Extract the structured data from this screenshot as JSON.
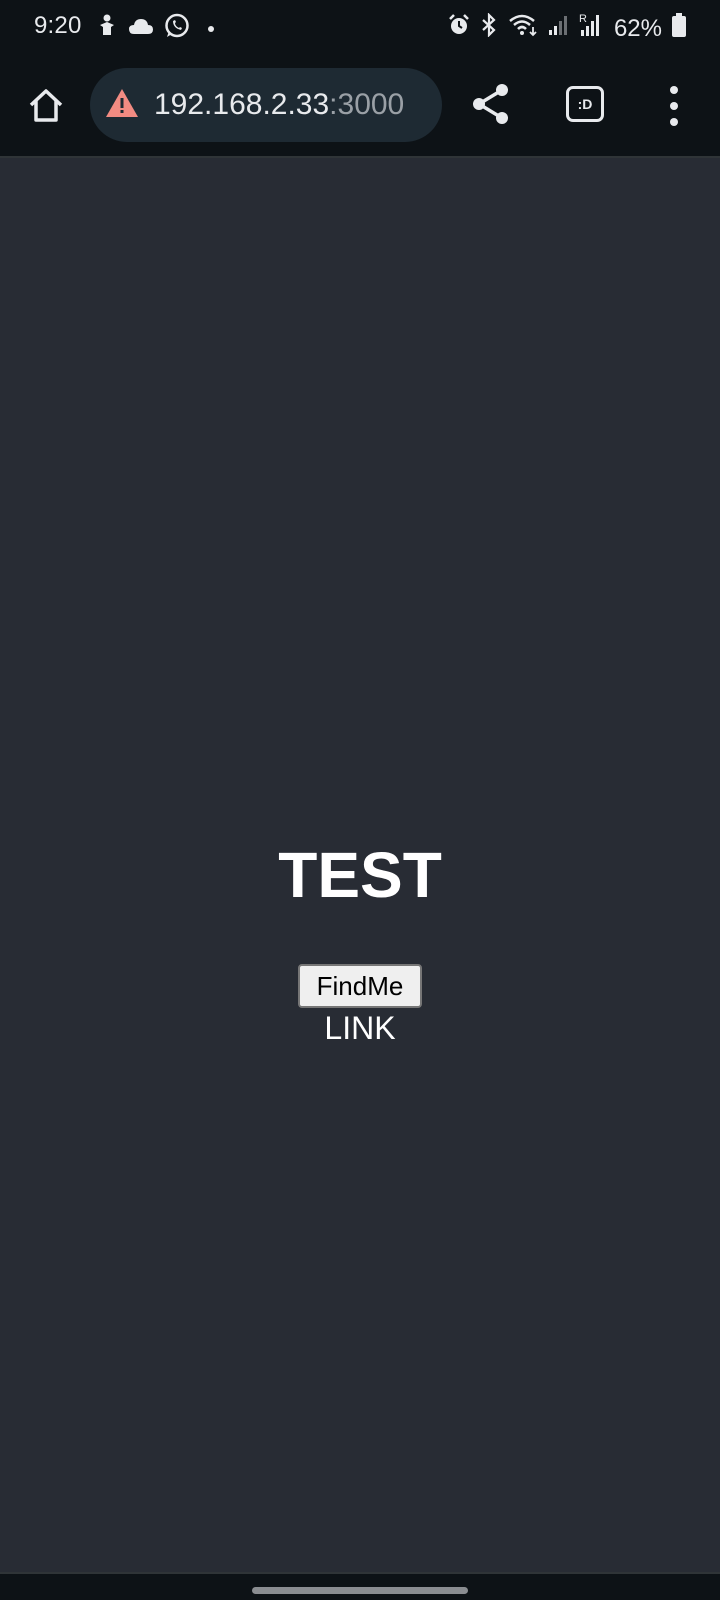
{
  "status_bar": {
    "time": "9:20",
    "left_icons": [
      "gesture-icon",
      "cloud-icon",
      "whatsapp-icon",
      "dot-icon"
    ],
    "right_icons": [
      "alarm-icon",
      "bluetooth-icon",
      "wifi-icon",
      "signal-icon",
      "signal-r-icon",
      "battery-icon"
    ],
    "battery_percent": "62%"
  },
  "browser": {
    "url_host": "192.168.2.33",
    "url_port": ":3000",
    "security_icon": "warning-icon",
    "tab_switcher_label": ":D",
    "warning_color": "#f28b82"
  },
  "page": {
    "background": "#282c34",
    "heading": "TEST",
    "button_label": "FindMe",
    "link_label": "LINK"
  }
}
